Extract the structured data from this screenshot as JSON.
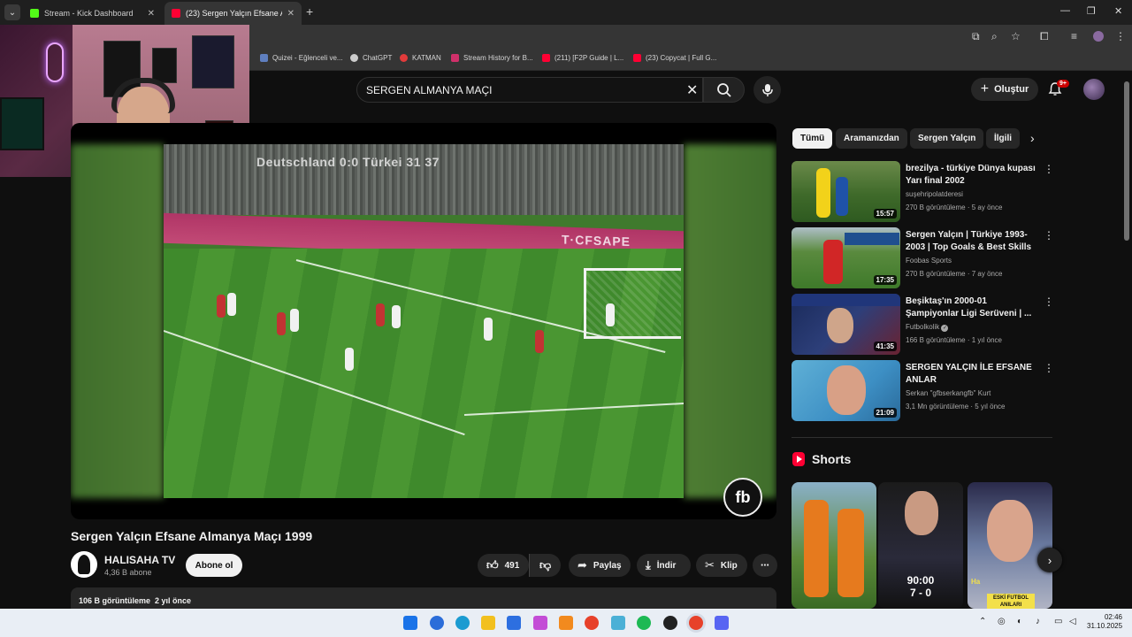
{
  "browser": {
    "tabs": [
      {
        "title": "Stream - Kick Dashboard",
        "favicon_color": "#53fc18",
        "active": false
      },
      {
        "title": "(23) Sergen Yalçın Efsane Alman",
        "favicon_color": "#ff0033",
        "active": true
      }
    ],
    "bookmarks": [
      {
        "label": "Quizei - Eğlenceli ve...",
        "color": "#5f7fbf"
      },
      {
        "label": "ChatGPT",
        "color": "#cccccc"
      },
      {
        "label": "KATMAN",
        "color": "#e23b3b"
      },
      {
        "label": "Stream History for B...",
        "color": "#d0306a"
      },
      {
        "label": "(211) [F2P Guide | L...",
        "color": "#ff0033"
      },
      {
        "label": "(23) Copycat | Full G...",
        "color": "#ff0033"
      }
    ]
  },
  "youtube": {
    "search_query": "SERGEN ALMANYA MAÇI",
    "create_label": "Oluştur",
    "notification_count": "9+",
    "video": {
      "scoreline": "Deutschland 0:0 Türkei   31   37",
      "ad_text": "T·CFSAPE",
      "watermark": "fb",
      "title": "Sergen Yalçın Efsane Almanya Maçı 1999",
      "channel": "HALISAHA TV",
      "subscribers": "4,36 B abone",
      "subscribe_label": "Abone ol",
      "likes": "491",
      "share_label": "Paylaş",
      "download_label": "İndir",
      "clip_label": "Klip",
      "views": "106 B görüntüleme",
      "age": "2 yıl önce"
    },
    "chips": [
      "Tümü",
      "Aramanızdan",
      "Sergen Yalçın",
      "İlgili"
    ],
    "recommendations": [
      {
        "title": "brezilya - türkiye Dünya kupası Yarı final 2002",
        "channel": "suşehripolatderesi",
        "views": "270 B görüntüleme",
        "age": "5 ay önce",
        "duration": "15:57",
        "verified": false
      },
      {
        "title": "Sergen Yalçın | Türkiye 1993-2003 | Top Goals & Best Skills ...",
        "channel": "Foobas Sports",
        "views": "270 B görüntüleme",
        "age": "7 ay önce",
        "duration": "17:35",
        "verified": false
      },
      {
        "title": "Beşiktaş'ın 2000-01 Şampiyonlar Ligi Serüveni | ...",
        "channel": "Futbolkolik",
        "views": "166 B görüntüleme",
        "age": "1 yıl önce",
        "duration": "41:35",
        "verified": true
      },
      {
        "title": "SERGEN YALÇIN İLE EFSANE ANLAR",
        "channel": "Serkan \"gfbserkangfb\" Kurt",
        "views": "3,1 Mn görüntüleme",
        "age": "5 yıl önce",
        "duration": "21:09",
        "verified": false
      }
    ],
    "shorts_title": "Shorts",
    "short_overlay_texts": [
      "90:00",
      "7 - 0",
      "ESKİ FUTBOL ANILARI",
      "Ha"
    ]
  },
  "taskbar": {
    "time": "02:46",
    "date": "31.10.2025"
  }
}
